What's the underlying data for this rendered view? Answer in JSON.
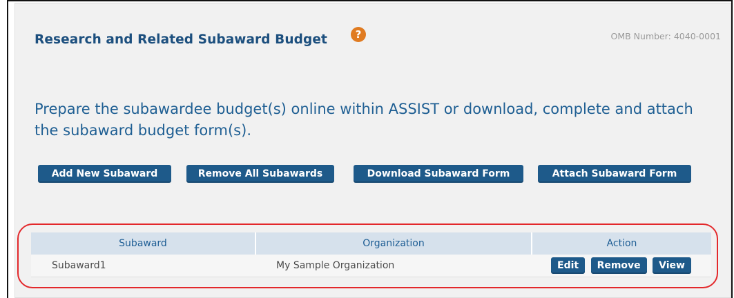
{
  "form": {
    "title": "Research and Related Subaward Budget",
    "help_icon": "question-circle-icon",
    "help_symbol": "?",
    "omb_number": "OMB Number: 4040-0001",
    "instructions": "Prepare the subawardee budget(s) online within ASSIST or download, complete and attach the subaward budget form(s)."
  },
  "toolbar": {
    "add_label": "Add New Subaward",
    "remove_all_label": "Remove All Subawards",
    "download_label": "Download Subaward Form",
    "attach_label": "Attach Subaward Form"
  },
  "table": {
    "headers": [
      "Subaward",
      "Organization",
      "Action"
    ],
    "rows": [
      {
        "subaward": "Subaward1",
        "organization": "My Sample Organization",
        "actions": [
          "Edit",
          "Remove",
          "View"
        ]
      }
    ]
  },
  "colors": {
    "button": "#1e5a8a",
    "title": "#1c4f7e",
    "help_icon": "#e07b21",
    "highlight": "#e3282b"
  }
}
